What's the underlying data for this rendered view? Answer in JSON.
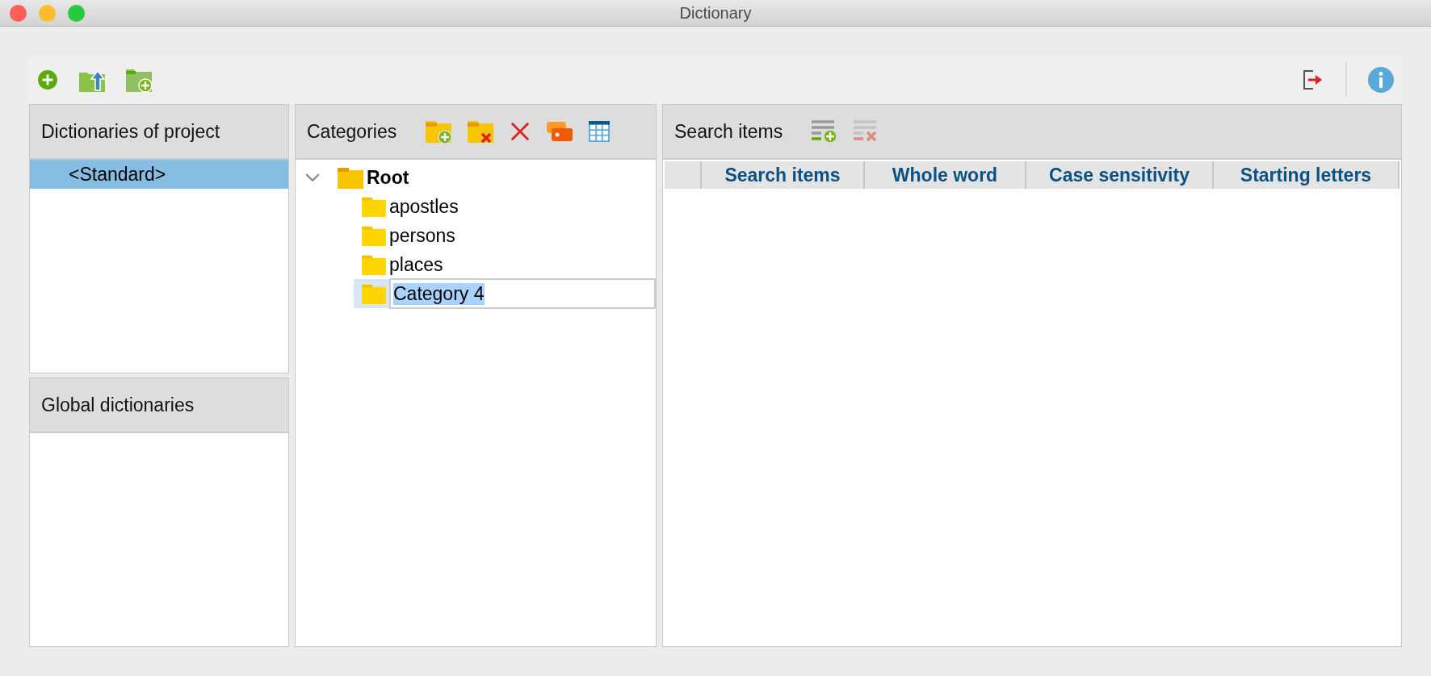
{
  "window": {
    "title": "Dictionary"
  },
  "dictionaries_of_project": {
    "title": "Dictionaries of project",
    "items": [
      {
        "label": "<Standard>",
        "selected": true
      }
    ]
  },
  "global_dictionaries": {
    "title": "Global dictionaries"
  },
  "categories": {
    "title": "Categories",
    "tree": {
      "label": "Root",
      "expanded": true,
      "children": [
        {
          "label": "apostles",
          "selected": false,
          "editing": false
        },
        {
          "label": "persons",
          "selected": false,
          "editing": false
        },
        {
          "label": "places",
          "selected": false,
          "editing": false
        },
        {
          "label": "Category 4",
          "selected": true,
          "editing": true
        }
      ]
    }
  },
  "search_items": {
    "title": "Search items",
    "columns": [
      "Search items",
      "Whole word",
      "Case sensitivity",
      "Starting letters"
    ]
  }
}
